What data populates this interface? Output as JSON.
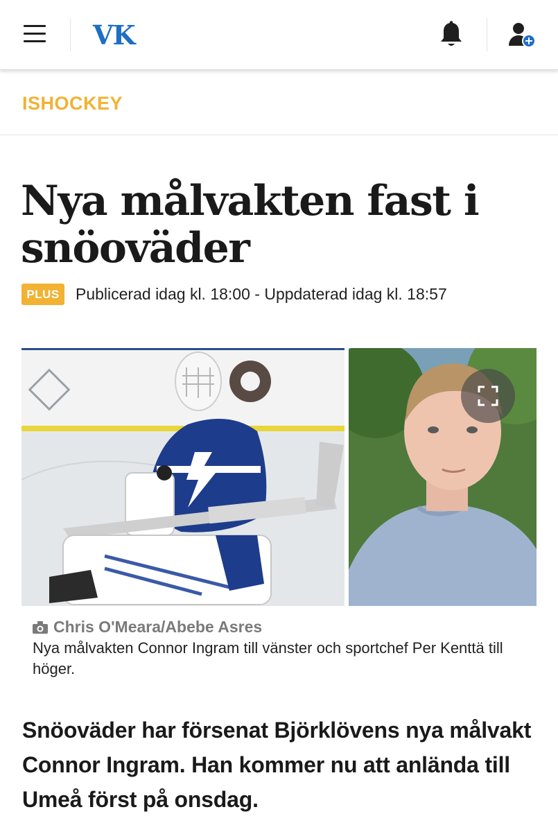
{
  "header": {
    "logo": "VK",
    "brand_color": "#1d6fc4",
    "icons": [
      "menu-icon",
      "bell-icon",
      "user-add-icon"
    ]
  },
  "section": {
    "label": "ISHOCKEY",
    "color": "#f2b233"
  },
  "article": {
    "headline": "Nya målvakten fast i snöoväder",
    "badge": "PLUS",
    "published": "Publicerad idag kl. 18:00 - Uppdaterad idag kl. 18:57",
    "photo_credit": "Chris O'Meara/Abebe Asres",
    "caption": "Nya målvakten Connor Ingram till vänster och sportchef Per Kenttä till höger.",
    "lead": "Snöoväder har försenat Björklövens nya målvakt Connor Ingram. Han kommer nu att anlända till Umeå först på onsdag."
  }
}
